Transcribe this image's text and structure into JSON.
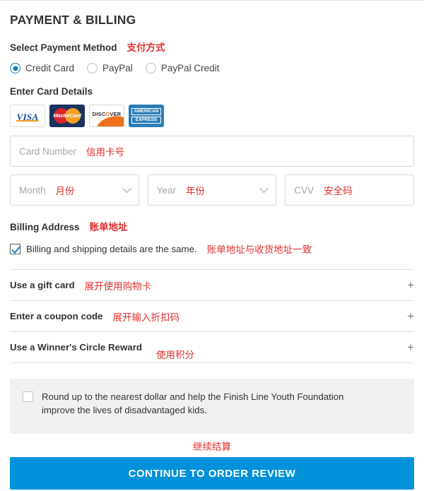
{
  "page_title": "PAYMENT & BILLING",
  "payment_method": {
    "label": "Select Payment Method",
    "annotation": "支付方式",
    "options": [
      {
        "label": "Credit Card",
        "selected": true
      },
      {
        "label": "PayPal",
        "selected": false
      },
      {
        "label": "PayPal Credit",
        "selected": false
      }
    ]
  },
  "card_details": {
    "label": "Enter Card Details",
    "logos": [
      {
        "name": "visa-card-logo",
        "text": "VISA"
      },
      {
        "name": "mastercard-card-logo",
        "text": "MasterCard"
      },
      {
        "name": "discover-card-logo",
        "text_before": "DISC",
        "text_o": "O",
        "text_after": "VER"
      },
      {
        "name": "amex-card-logo",
        "line1": "AMERICAN",
        "line2": "EXPRESS"
      }
    ],
    "card_number": {
      "placeholder": "Card Number",
      "value": "",
      "annotation": "信用卡号"
    },
    "month": {
      "placeholder": "Month",
      "value": "",
      "annotation": "月份"
    },
    "year": {
      "placeholder": "Year",
      "value": "",
      "annotation": "年份"
    },
    "cvv": {
      "placeholder": "CVV",
      "value": "",
      "annotation": "安全码"
    }
  },
  "billing_address": {
    "label": "Billing Address",
    "annotation": "账单地址",
    "same_as_shipping": {
      "label": "Billing and shipping details are the same.",
      "checked": true,
      "annotation": "账单地址与收货地址一致"
    }
  },
  "accordions": [
    {
      "label": "Use a gift card",
      "annotation": "展开使用购物卡",
      "toggle": "+"
    },
    {
      "label": "Enter a coupon code",
      "annotation": "展开输入折扣码",
      "toggle": "+"
    },
    {
      "label": "Use a Winner's Circle Reward",
      "annotation": "使用积分",
      "toggle": "+"
    }
  ],
  "round_up": {
    "checked": false,
    "text": "Round up to the nearest dollar and help the Finish Line Youth Foundation improve the lives of disadvantaged kids."
  },
  "cta": {
    "label": "CONTINUE TO ORDER REVIEW",
    "annotation": "继续结算",
    "color": "#0091da"
  }
}
